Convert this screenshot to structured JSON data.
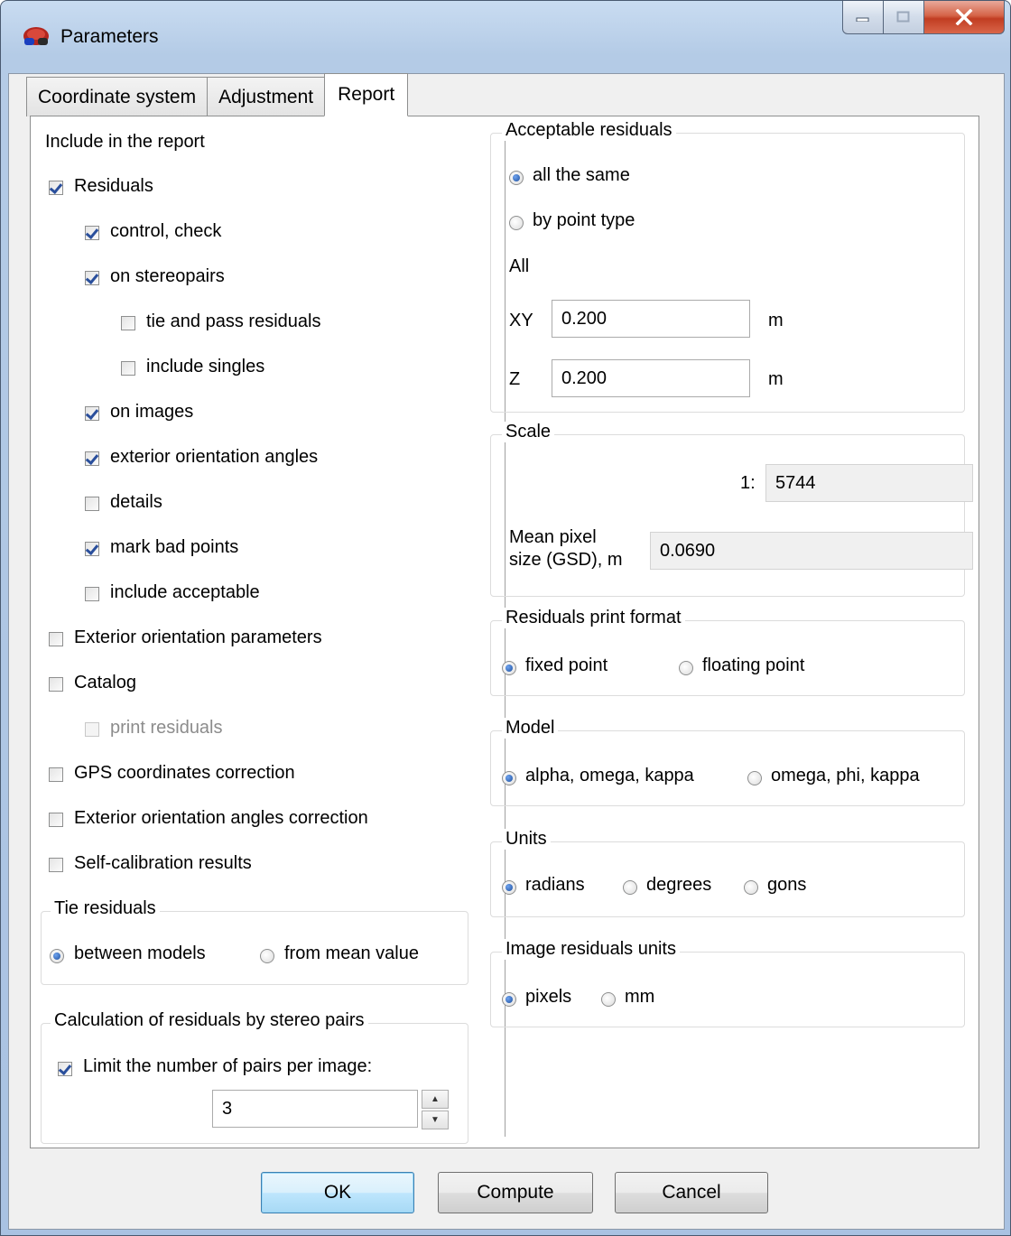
{
  "window": {
    "title": "Parameters"
  },
  "tabs": [
    {
      "label": "Coordinate system"
    },
    {
      "label": "Adjustment"
    },
    {
      "label": "Report"
    }
  ],
  "left": {
    "include_heading": "Include in the report",
    "residuals": {
      "label": "Residuals",
      "checked": true
    },
    "control_check": {
      "label": "control, check",
      "checked": true
    },
    "on_stereopairs": {
      "label": "on stereopairs",
      "checked": true
    },
    "tie_pass": {
      "label": "tie and pass residuals",
      "checked": false
    },
    "include_singles": {
      "label": "include singles",
      "checked": false
    },
    "on_images": {
      "label": "on images",
      "checked": true
    },
    "ext_angles": {
      "label": "exterior orientation angles",
      "checked": true
    },
    "details": {
      "label": "details",
      "checked": false
    },
    "mark_bad": {
      "label": "mark bad points",
      "checked": true
    },
    "include_acceptable": {
      "label": "include acceptable",
      "checked": false
    },
    "ext_params": {
      "label": "Exterior orientation parameters",
      "checked": false
    },
    "catalog": {
      "label": "Catalog",
      "checked": false
    },
    "print_residuals": {
      "label": "print residuals",
      "checked": false,
      "disabled": true
    },
    "gps_correction": {
      "label": "GPS coordinates correction",
      "checked": false
    },
    "ext_angles_correction": {
      "label": "Exterior orientation angles correction",
      "checked": false
    },
    "self_calibration": {
      "label": "Self-calibration results",
      "checked": false
    },
    "tie_residuals": {
      "title": "Tie residuals",
      "options": [
        "between models",
        "from mean value"
      ],
      "selected": 0
    },
    "stereo_calc": {
      "title": "Calculation of residuals by stereo pairs",
      "limit_label": "Limit the number of pairs per image:",
      "limit_checked": true,
      "pairs_value": "3"
    }
  },
  "right": {
    "acceptable": {
      "title": "Acceptable residuals",
      "options": [
        "all the same",
        "by point type"
      ],
      "selected": 0,
      "all_label": "All",
      "xy_label": "XY",
      "xy_value": "0.200",
      "xy_unit": "m",
      "z_label": "Z",
      "z_value": "0.200",
      "z_unit": "m"
    },
    "scale": {
      "title": "Scale",
      "ratio_label": "1:",
      "ratio_value": "5744",
      "gsd_label_1": "Mean pixel",
      "gsd_label_2": "size (GSD), m",
      "gsd_value": "0.0690"
    },
    "print_format": {
      "title": "Residuals print format",
      "options": [
        "fixed point",
        "floating point"
      ],
      "selected": 0
    },
    "model": {
      "title": "Model",
      "options": [
        "alpha, omega, kappa",
        "omega, phi, kappa"
      ],
      "selected": 0
    },
    "units": {
      "title": "Units",
      "options": [
        "radians",
        "degrees",
        "gons"
      ],
      "selected": 0
    },
    "image_units": {
      "title": "Image residuals units",
      "options": [
        "pixels",
        "mm"
      ],
      "selected": 0
    }
  },
  "buttons": {
    "ok": "OK",
    "compute": "Compute",
    "cancel": "Cancel"
  },
  "colors": {
    "accent": "#1d4f9e",
    "close_button": "#c13d22",
    "default_button": "#3c7fb1"
  }
}
